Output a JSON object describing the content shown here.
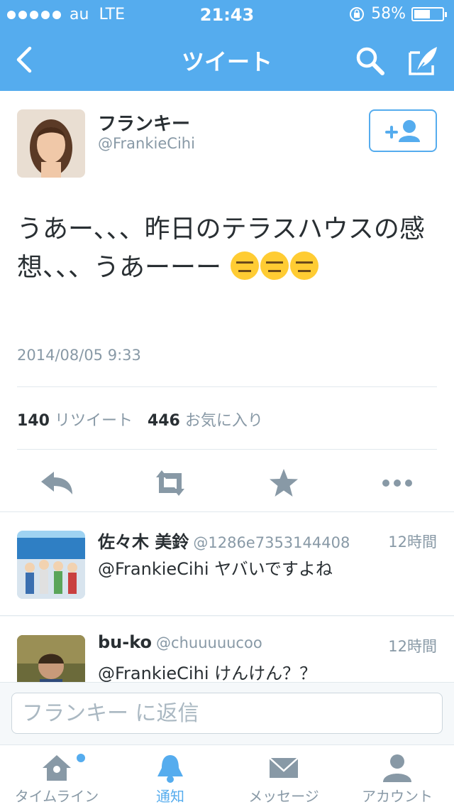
{
  "status": {
    "carrier": "au",
    "network": "LTE",
    "time": "21:43",
    "battery": "58%"
  },
  "nav": {
    "title": "ツイート",
    "icons": [
      "back-icon",
      "search-icon",
      "compose-icon"
    ]
  },
  "author": {
    "name": "フランキー",
    "handle": "@FrankieCihi"
  },
  "tweet": {
    "text": "うあー、、、昨日のテラスハウスの感想、、、うあーーー",
    "emoji": "expressionless-face x3",
    "date": "2014/08/05 9:33",
    "retweets": "140",
    "retweets_label": "リツイート",
    "favorites": "446",
    "favorites_label": "お気に入り"
  },
  "replies": [
    {
      "name": "佐々木 美鈴",
      "handle": "@1286e7353144408",
      "time": "12時間",
      "text": "@FrankieCihi ヤバいですよね"
    },
    {
      "name": "bu-ko",
      "handle": "@chuuuuucoo",
      "time": "12時間",
      "text": "@FrankieCihi けんけん？？"
    }
  ],
  "reply_box": {
    "placeholder": "フランキー に返信"
  },
  "tabs": [
    {
      "label": "タイムライン",
      "icon": "home-icon"
    },
    {
      "label": "通知",
      "icon": "bell-icon",
      "active": true
    },
    {
      "label": "メッセージ",
      "icon": "envelope-icon"
    },
    {
      "label": "アカウント",
      "icon": "person-icon"
    }
  ],
  "colors": {
    "accent": "#55acee",
    "text": "#292f33",
    "muted": "#8899a6",
    "divider": "#e1e8ed"
  }
}
